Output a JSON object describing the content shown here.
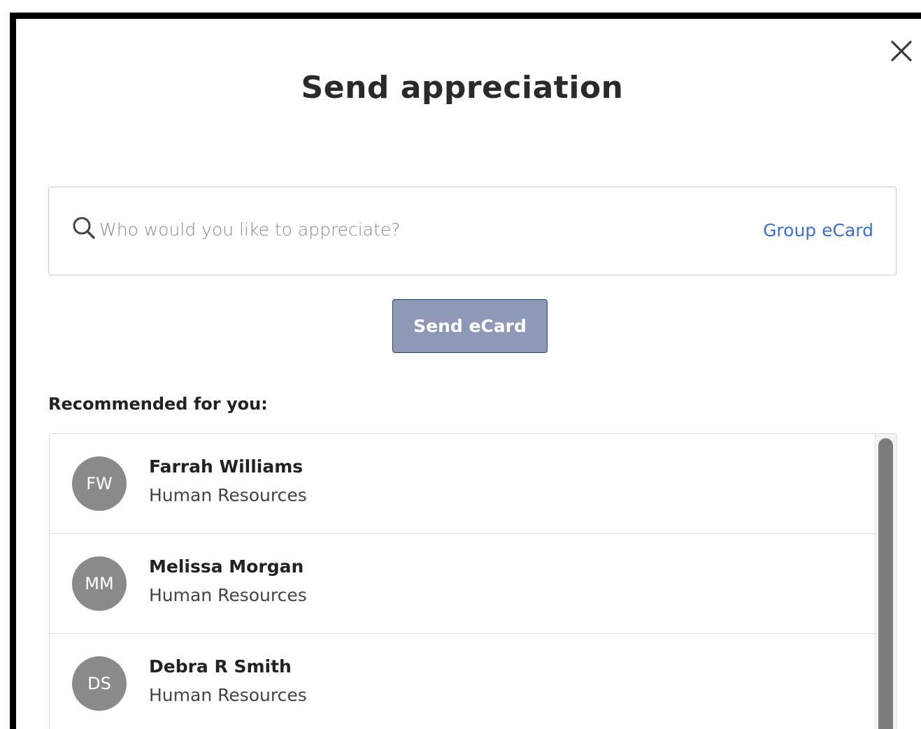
{
  "dialog": {
    "title": "Send appreciation",
    "close_icon": "close-icon"
  },
  "search": {
    "placeholder": "Who would you like to appreciate?",
    "value": "",
    "icon": "search-icon",
    "group_link": "Group eCard"
  },
  "actions": {
    "send_label": "Send eCard"
  },
  "recommended": {
    "heading": "Recommended for you:",
    "items": [
      {
        "initials": "FW",
        "name": "Farrah Williams",
        "department": "Human Resources"
      },
      {
        "initials": "MM",
        "name": "Melissa Morgan",
        "department": "Human Resources"
      },
      {
        "initials": "DS",
        "name": "Debra R Smith",
        "department": "Human Resources"
      }
    ]
  },
  "colors": {
    "accent_link": "#3d6fd1",
    "button_bg": "#8e99b8",
    "button_border": "#2f3f78",
    "avatar_bg": "#8a8a8a"
  }
}
